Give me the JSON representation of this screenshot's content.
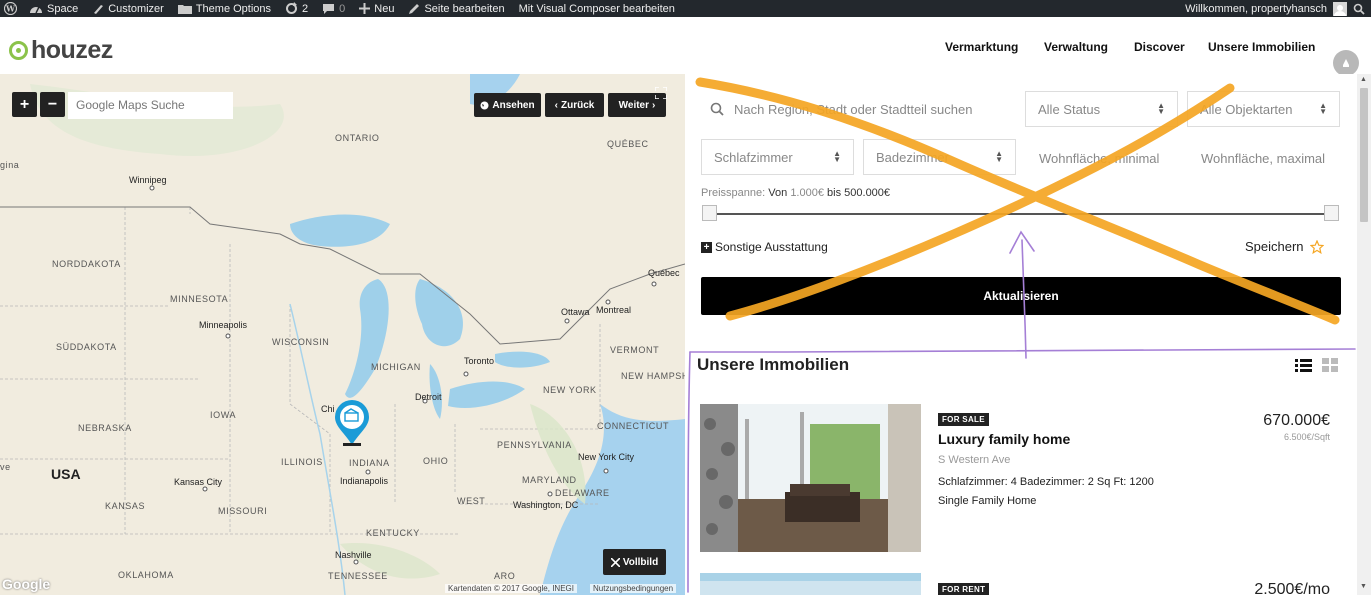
{
  "adminbar": {
    "items": [
      "Space",
      "Customizer",
      "Theme Options",
      "2",
      "0",
      "Neu",
      "Seite bearbeiten",
      "Mit Visual Composer bearbeiten"
    ],
    "welcome": "Willkommen, propertyhansch"
  },
  "header": {
    "logo": "houzez",
    "nav": [
      "Vermarktung",
      "Verwaltung",
      "Discover",
      "Unsere Immobilien"
    ]
  },
  "map": {
    "zoom_in": "+",
    "zoom_out": "−",
    "search_placeholder": "Google Maps Suche",
    "btn_view": "Ansehen",
    "btn_back": "Zurück",
    "btn_next": "Weiter",
    "btn_fullscreen": "Vollbild",
    "footer_data": "Kartendaten © 2017 Google, INEGI",
    "footer_terms": "Nutzungsbedingungen",
    "google": "Google",
    "labels": [
      "ONTARIO",
      "QUÉBEC",
      "NORDDAKOTA",
      "MINNESOTA",
      "SÜDDAKOTA",
      "WISCONSIN",
      "MICHIGAN",
      "IOWA",
      "NEBRASKA",
      "ILLINOIS",
      "INDIANA",
      "OHIO",
      "PENNSYLVANIA",
      "NEW YORK",
      "VERMONT",
      "NEW HAMPSHIR",
      "CONNECTICUT",
      "MARYLAND",
      "DELAWARE",
      "WEST",
      "KANSAS",
      "MISSOURI",
      "KENTUCKY",
      "OKLAHOMA",
      "TENNESSEE",
      "gina",
      "ve",
      "ARO"
    ],
    "cities": [
      "Winnipeg",
      "Québec",
      "Ottawa",
      "Montreal",
      "Minneapolis",
      "Toronto",
      "Detroit",
      "Chi",
      "Indianapolis",
      "Kansas City",
      "New York City",
      "Washington, DC",
      "Nashville"
    ],
    "country": "USA"
  },
  "search": {
    "location_placeholder": "Nach Region, Stadt oder Stadtteil suchen",
    "status": "Alle Status",
    "type": "Alle Objektarten",
    "bedrooms": "Schlafzimmer",
    "bathrooms": "Badezimmer",
    "area_min": "Wohnfläche, minimal",
    "area_max": "Wohnfläche, maximal",
    "price_label": "Preisspanne:",
    "price_from_word": "Von",
    "price_min": "1.000€",
    "price_to_word": "bis",
    "price_max": "500.000€",
    "more_features": "Sonstige Ausstattung",
    "save": "Speichern",
    "update": "Aktualisieren"
  },
  "listings": {
    "title": "Unsere Immobilien",
    "items": [
      {
        "badge": "FOR SALE",
        "title": "Luxury family home",
        "address": "S Western Ave",
        "features": "Schlafzimmer: 4   Badezimmer: 2   Sq Ft: 1200",
        "type": "Single Family Home",
        "price": "670.000€",
        "price_sqft": "6.500€/Sqft"
      },
      {
        "badge": "FOR RENT",
        "price": "2.500€/mo"
      }
    ]
  },
  "colors": {
    "accent_green": "#8bc34a",
    "marker_blue": "#1a9bd7",
    "annotation_orange": "#f5a623",
    "annotation_purple": "#a57fd6"
  }
}
